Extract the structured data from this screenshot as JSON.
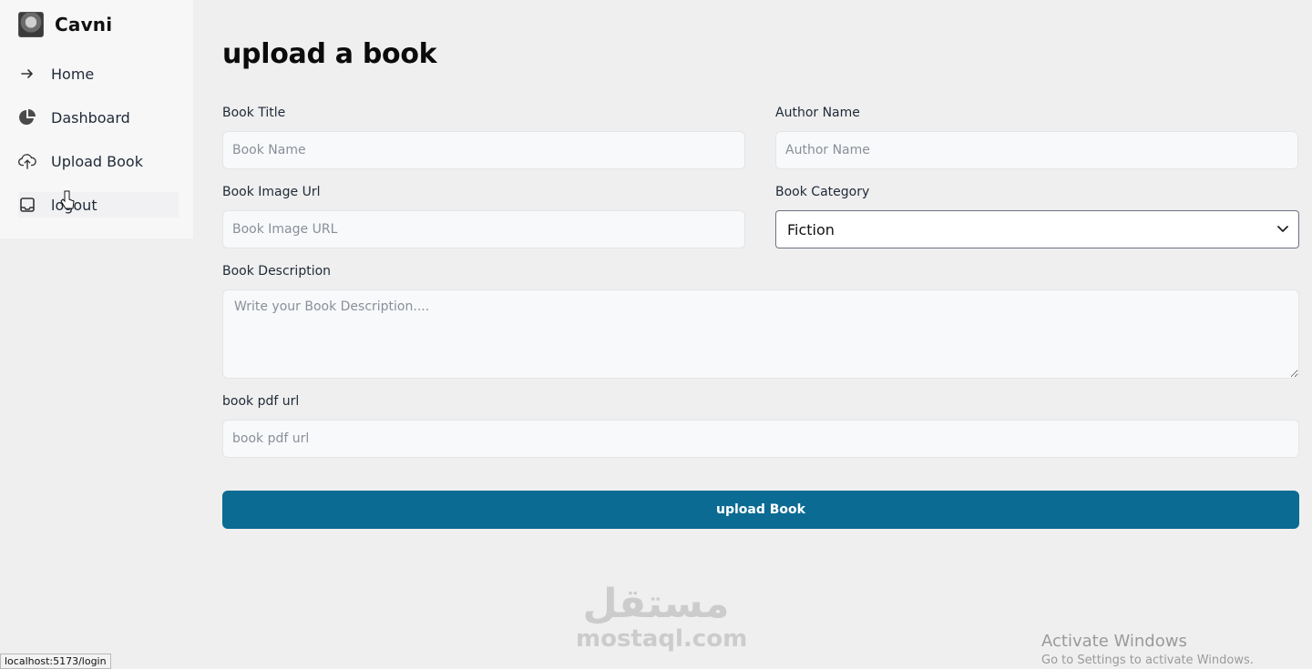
{
  "brand": {
    "name": "Cavni"
  },
  "sidebar": {
    "items": [
      {
        "label": "Home",
        "icon": "arrow-right-icon"
      },
      {
        "label": "Dashboard",
        "icon": "pie-chart-icon"
      },
      {
        "label": "Upload Book",
        "icon": "cloud-upload-icon"
      },
      {
        "label": "logout",
        "icon": "inbox-icon"
      }
    ]
  },
  "page": {
    "title": "upload a book"
  },
  "form": {
    "book_title": {
      "label": "Book Title",
      "placeholder": "Book Name"
    },
    "author_name": {
      "label": "Author Name",
      "placeholder": "Author Name"
    },
    "book_image_url": {
      "label": "Book Image Url",
      "placeholder": "Book Image URL"
    },
    "book_category": {
      "label": "Book Category",
      "value": "Fiction"
    },
    "book_description": {
      "label": "Book Description",
      "placeholder": "Write your Book Description...."
    },
    "book_pdf_url": {
      "label": "book pdf url",
      "placeholder": "book pdf url"
    },
    "submit_label": "upload Book"
  },
  "overlay": {
    "watermark_ar": "مستقل",
    "watermark_en": "mostaql.com",
    "activate_title": "Activate Windows",
    "activate_sub": "Go to Settings to activate Windows.",
    "status_url": "localhost:5173/login"
  },
  "colors": {
    "primary": "#0b6b93",
    "background": "#efefef",
    "sidebar": "#f7f7f8"
  }
}
